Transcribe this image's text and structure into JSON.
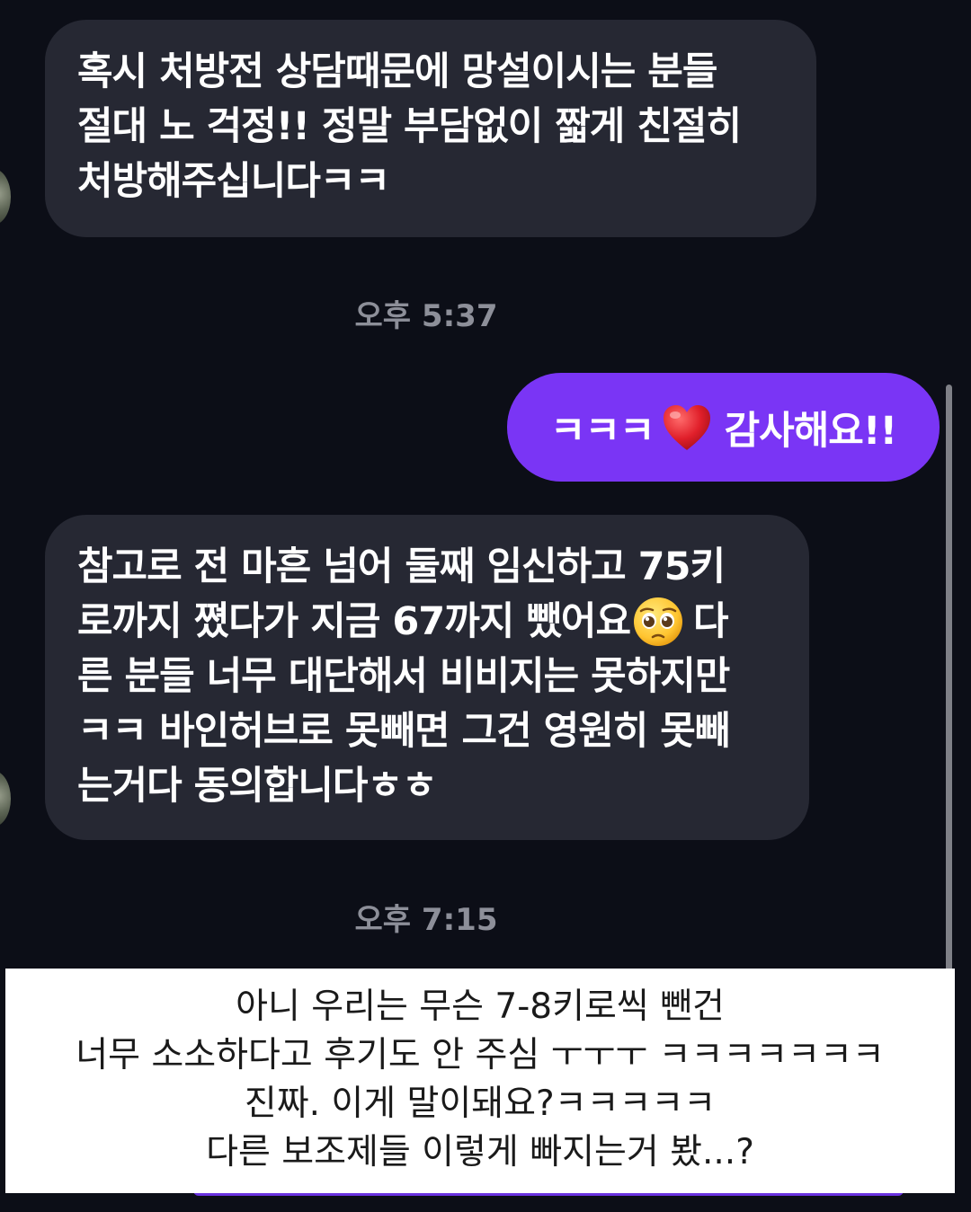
{
  "messages": {
    "m1": {
      "lines": [
        "혹시 처방전 상담때문에 망설이시는 분들",
        "절대 노 걱정!! 정말 부담없이 짧게 친절히",
        "처방해주십니다ㅋㅋ"
      ]
    },
    "ts1": "오후 5:37",
    "m2": {
      "prefix": "ㅋㅋㅋ",
      "emoji": "red-heart",
      "suffix": "감사해요!!"
    },
    "m3": {
      "line1": "참고로 전 마흔 넘어 둘째 임신하고 75키",
      "line2_a": "로까지 쪘다가 지금 67까지 뺐어요",
      "line2_emoji": "pleading-face",
      "line2_b": "다",
      "line3": "른 분들 너무 대단해서 비비지는 못하지만",
      "line4": "ㅋㅋ 바인허브로 못빼면 그건 영원히 못빼",
      "line5": "는거다 동의합니다ㅎㅎ"
    },
    "ts2": "오후 7:15"
  },
  "caption": {
    "lines": [
      "아니 우리는 무슨 7-8키로씩 뺀건",
      "너무 소소하다고 후기도 안 주심 ㅜㅜㅜ ㅋㅋㅋㅋㅋㅋㅋ",
      "진짜. 이게 말이돼요?ㅋㅋㅋㅋㅋ",
      "다른 보조제들 이렇게 빠지는거 봤...?"
    ]
  },
  "colors": {
    "background": "#0c0e17",
    "incoming_bubble": "#262833",
    "outgoing_bubble": "#7a35f5",
    "timestamp": "#8d8f99"
  }
}
